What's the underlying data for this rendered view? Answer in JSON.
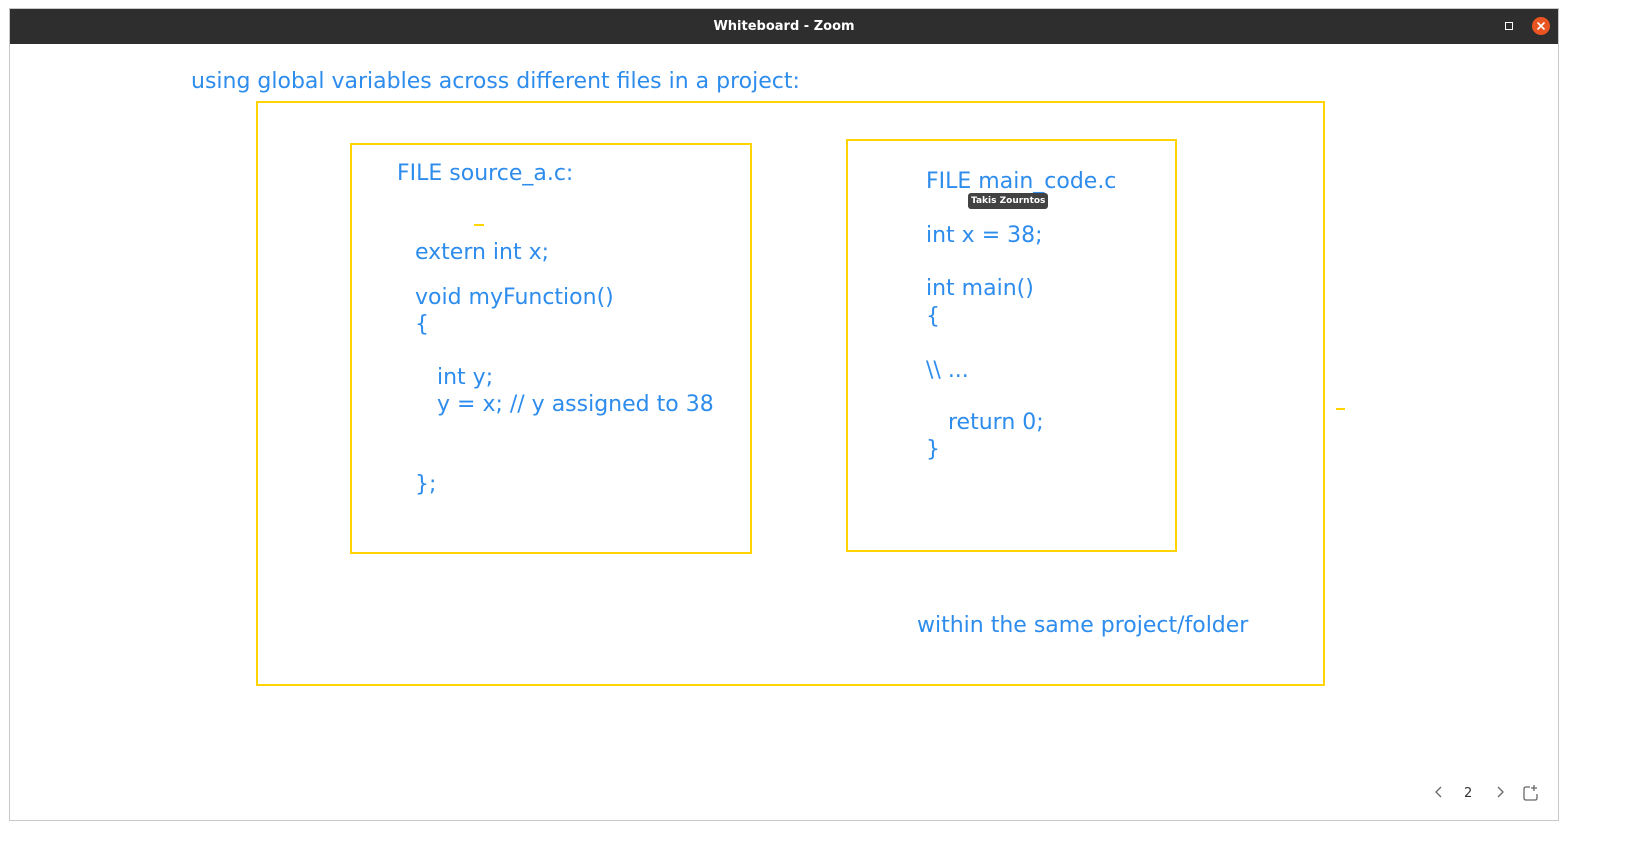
{
  "window": {
    "title": "Whiteboard - Zoom"
  },
  "whiteboard": {
    "heading": "using global variables across different files in a project:",
    "file_a": {
      "title": "FILE source_a.c:",
      "lines": [
        "extern int x;",
        "void myFunction()",
        "{",
        "int y;",
        "y = x; // y assigned to 38",
        "};"
      ]
    },
    "file_b": {
      "title": "FILE main_code.c",
      "lines": [
        "int x = 38;",
        "int main()",
        "{",
        "\\\\ ...",
        "return 0;",
        "}"
      ]
    },
    "note": "within the same project/folder",
    "annotator_name": "Takis Zourntos"
  },
  "pager": {
    "page": "2"
  },
  "colors": {
    "ink": "#2d8cec",
    "frame": "#ffd400",
    "titlebar": "#2e2e2e",
    "close": "#e95420"
  },
  "icons": {
    "maximize": "maximize-icon",
    "close": "close-icon",
    "prev": "chevron-left-icon",
    "next": "chevron-right-icon",
    "share": "share-page-icon"
  }
}
